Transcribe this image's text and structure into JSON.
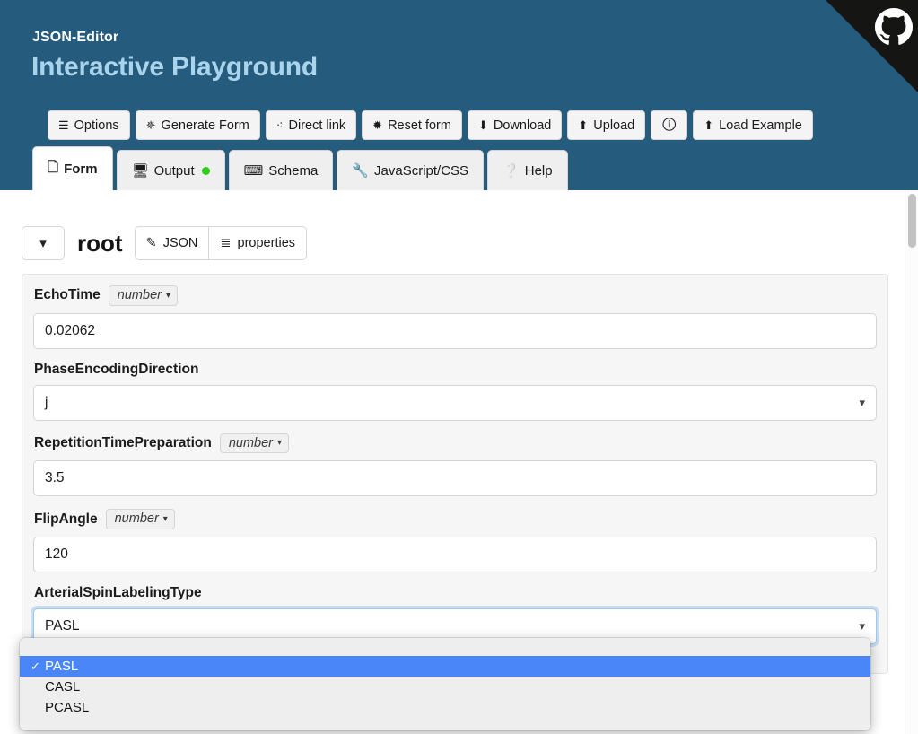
{
  "header": {
    "brand": "JSON-Editor",
    "title": "Interactive Playground",
    "ribbon_icon": "github-octocat-icon"
  },
  "toolbar": {
    "buttons": [
      {
        "label": "Options",
        "icon": "hamburger-icon",
        "glyph": "☰"
      },
      {
        "label": "Generate Form",
        "icon": "gear-icon",
        "glyph": "⚙"
      },
      {
        "label": "Direct link",
        "icon": "link-icon",
        "glyph": "%"
      },
      {
        "label": "Reset form",
        "icon": "reset-icon",
        "glyph": "❇"
      },
      {
        "label": "Download",
        "icon": "download-icon",
        "glyph": "⤓"
      },
      {
        "label": "Upload",
        "icon": "upload-icon",
        "glyph": "⤒"
      },
      {
        "label": "",
        "icon": "info-icon",
        "glyph": "ℹ"
      },
      {
        "label": "Load Example",
        "icon": "upload-icon",
        "glyph": "⤒"
      }
    ]
  },
  "tabs": [
    {
      "label": "Form",
      "icon": "form-icon",
      "glyph": "὜F",
      "active": true,
      "status_dot": false
    },
    {
      "label": "Output",
      "icon": "monitor-icon",
      "glyph": "Ὓ5",
      "active": false,
      "status_dot": true
    },
    {
      "label": "Schema",
      "icon": "keyboard-icon",
      "glyph": "⌨",
      "active": false,
      "status_dot": false
    },
    {
      "label": "JavaScript/CSS",
      "icon": "wrench-icon",
      "glyph": "ὒ7",
      "active": false,
      "status_dot": false
    },
    {
      "label": "Help",
      "icon": "question-icon",
      "glyph": "?",
      "active": false,
      "status_dot": false
    }
  ],
  "editor": {
    "collapse_icon": "chevron-down-icon",
    "root_label": "root",
    "json_button": "JSON",
    "json_icon": "pencil-icon",
    "properties_button": "properties",
    "properties_icon": "list-icon",
    "fields": [
      {
        "label": "EchoTime",
        "type_pill": "number",
        "control": "text",
        "value": "0.02062"
      },
      {
        "label": "PhaseEncodingDirection",
        "type_pill": "",
        "control": "select",
        "value": "j"
      },
      {
        "label": "RepetitionTimePreparation",
        "type_pill": "number",
        "control": "text",
        "value": "3.5"
      },
      {
        "label": "FlipAngle",
        "type_pill": "number",
        "control": "text",
        "value": "120"
      },
      {
        "label": "ArterialSpinLabelingType",
        "type_pill": "",
        "control": "select",
        "value": "PASL"
      }
    ]
  },
  "dropdown": {
    "open_for": "ArterialSpinLabelingType",
    "selected": "PASL",
    "options": [
      {
        "label": "PASL",
        "selected": true
      },
      {
        "label": "CASL",
        "selected": false
      },
      {
        "label": "PCASL",
        "selected": false
      }
    ],
    "highlight_color": "#4a86f7"
  },
  "scrollbar": {
    "orientation": "vertical",
    "position": "top"
  },
  "colors": {
    "header_bg": "#255b7d",
    "title_accent": "#a9d4ec",
    "panel_bg": "#f6f6f6",
    "status_dot": "#2ecc16"
  }
}
